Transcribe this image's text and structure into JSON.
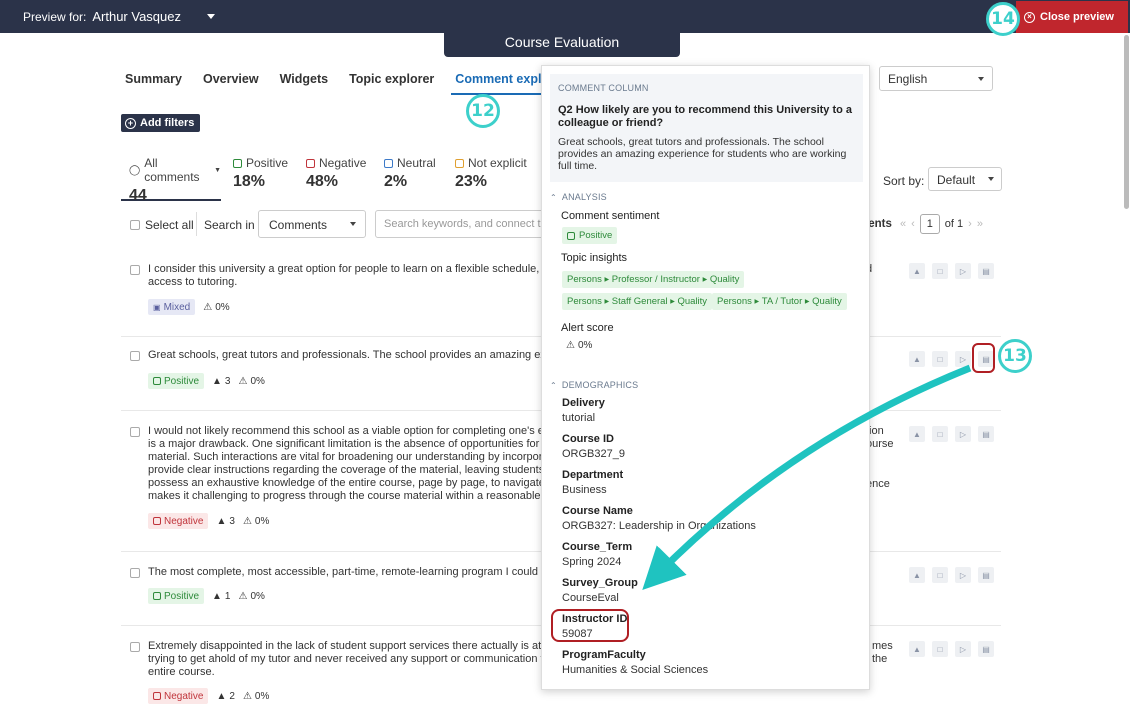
{
  "topbar": {
    "preview_label": "Preview for:",
    "preview_name": "Arthur Vasquez",
    "close_label": "Close preview",
    "eval_tab": "Course Evaluation"
  },
  "annotations": {
    "a12": "12",
    "a13": "13",
    "a14": "14"
  },
  "nav": [
    "Summary",
    "Overview",
    "Widgets",
    "Topic explorer",
    "Comment explorer"
  ],
  "language": {
    "label": ":",
    "value": "English"
  },
  "add_filters": "Add filters",
  "sentiments": [
    {
      "label": "All comments",
      "value": "44",
      "color": "#555555"
    },
    {
      "label": "Positive",
      "value": "18%",
      "color": "#2d8a3a"
    },
    {
      "label": "Negative",
      "value": "48%",
      "color": "#c0343b"
    },
    {
      "label": "Neutral",
      "value": "2%",
      "color": "#3d7ac8"
    },
    {
      "label": "Not explicit",
      "value": "23%",
      "color": "#e0a030"
    }
  ],
  "sort": {
    "label": "Sort by:",
    "value": "Default"
  },
  "toolbar": {
    "select_all": "Select all",
    "search_in": "Search in",
    "search_scope": "Comments",
    "search_placeholder": "Search keywords, and connect them",
    "comments_suffix": "ments",
    "page": "1",
    "of_label": "of 1"
  },
  "comments": [
    {
      "lines": [
        "I consider this university a great option for people to learn on a flexible schedule, but I f",
        "access to tutoring."
      ],
      "right": [
        "d"
      ],
      "sentiment": "Mixed",
      "alerts": "0%",
      "users": ""
    },
    {
      "lines": [
        "Great schools, great tutors and professionals. The school provides an amazing experien"
      ],
      "right": [],
      "sentiment": "Positive",
      "alerts": "0%",
      "users": "3"
    },
    {
      "lines": [
        "I would not likely recommend this school as a viable option for completing one's educat",
        "is a major drawback.  One significant limitation is the absence of opportunities for enga",
        "material.  Such interactions are vital for broadening our understanding by incorporatin",
        "provide clear instructions regarding the coverage of the material, leaving students unc",
        "possess an exhaustive knowledge of the entire course, page by page, to navigate throug",
        "makes it challenging to progress through the course material within a reasonable timef"
      ],
      "right": [
        "tion",
        "ourse",
        "",
        "",
        "ence",
        ""
      ],
      "sentiment": "Negative",
      "alerts": "0%",
      "users": "3"
    },
    {
      "lines": [
        "The most complete, most accessible, part-time, remote-learning program I could find."
      ],
      "right": [],
      "sentiment": "Positive",
      "alerts": "0%",
      "users": "1"
    },
    {
      "lines": [
        "Extremely disappointed in the lack of student support services there actually is at this u",
        "trying to get ahold of my tutor and never received any support or communication from",
        "entire course."
      ],
      "right": [
        "mes",
        "the",
        ""
      ],
      "sentiment": "Negative",
      "alerts": "0%",
      "users": "2"
    }
  ],
  "panel": {
    "column_caption": "COMMENT COLUMN",
    "question": "Q2 How likely are you to recommend this University to a colleague or friend?",
    "answer": "Great schools, great tutors and professionals. The school provides an amazing experience for students who are working full time.",
    "analysis_caption": "ANALYSIS",
    "sentiment_label": "Comment sentiment",
    "sentiment_value": "Positive",
    "insights_label": "Topic insights",
    "insights": [
      [
        "Persons",
        "Professor / Instructor",
        "Quality"
      ],
      [
        "Persons",
        "Staff General",
        "Quality"
      ],
      [
        "Persons",
        "TA / Tutor",
        "Quality"
      ]
    ],
    "alert_label": "Alert score",
    "alert_value": "0%",
    "demographics_caption": "DEMOGRAPHICS",
    "demographics": [
      {
        "label": "Delivery",
        "value": "tutorial"
      },
      {
        "label": "Course ID",
        "value": "ORGB327_9"
      },
      {
        "label": "Department",
        "value": "Business"
      },
      {
        "label": "Course Name",
        "value": "ORGB327: Leadership in Organizations"
      },
      {
        "label": "Course_Term",
        "value": "Spring 2024"
      },
      {
        "label": "Survey_Group",
        "value": "CourseEval"
      },
      {
        "label": "Instructor ID",
        "value": "59087"
      },
      {
        "label": "ProgramFaculty",
        "value": "Humanities & Social Sciences"
      }
    ]
  },
  "colors": {
    "accent": "#3dd0cb",
    "navy": "#2b3349",
    "close_red": "#c0262d",
    "link_blue": "#1a6bb5"
  }
}
